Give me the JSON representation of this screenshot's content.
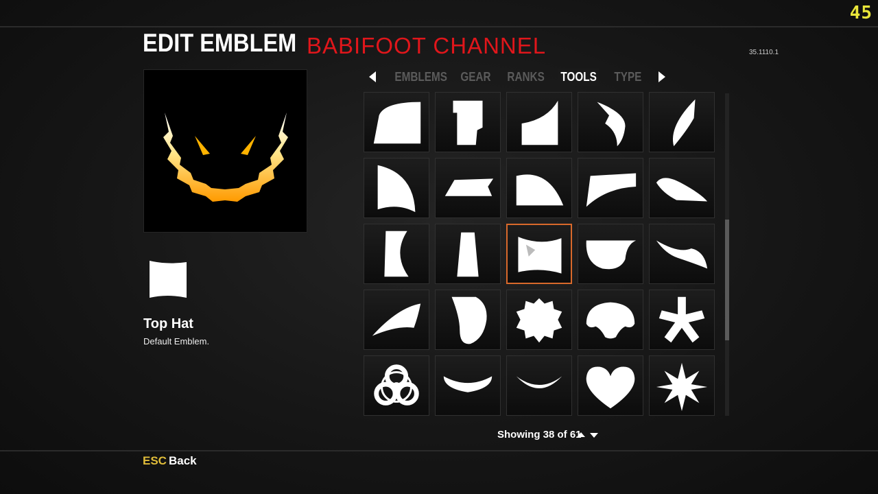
{
  "hud": {
    "fps": "45",
    "version": "35.1110.1"
  },
  "header": {
    "title": "EDIT EMBLEM",
    "channel_overlay": "BABIFOOT CHANNEL"
  },
  "tabs": [
    {
      "label": "EMBLEMS",
      "active": false
    },
    {
      "label": "GEAR",
      "active": false
    },
    {
      "label": "RANKS",
      "active": false
    },
    {
      "label": "TOOLS",
      "active": true
    },
    {
      "label": "TYPE",
      "active": false
    }
  ],
  "selected_item": {
    "name": "Top Hat",
    "description": "Default Emblem."
  },
  "grid": {
    "selected_index": 12,
    "highlight_color": "#d9692b",
    "items": [
      "quarter-round-shape-icon",
      "notched-rectangle-shape-icon",
      "ramp-curve-shape-icon",
      "hook-shape-icon",
      "thorn-shape-icon",
      "wing-shape-icon",
      "parallelogram-shape-icon",
      "dome-shape-icon",
      "swoosh-shape-icon",
      "fin-shape-icon",
      "crescent-notch-shape-icon",
      "trapezoid-shape-icon",
      "wave-flag-shape-icon",
      "bowl-shape-icon",
      "tail-curve-shape-icon",
      "blade-shape-icon",
      "shield-shape-icon",
      "star-badge-shape-icon",
      "mushroom-shape-icon",
      "asterisk-shape-icon",
      "biohazard-icon",
      "arc-band-shape-icon",
      "thin-arc-shape-icon",
      "heart-icon",
      "star-burst-icon"
    ]
  },
  "footer": {
    "showing": "Showing 38 of 61",
    "esc_key": "ESC",
    "esc_label": "Back"
  }
}
